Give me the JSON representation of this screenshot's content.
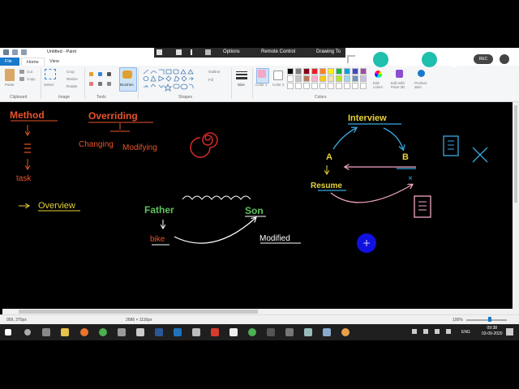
{
  "window": {
    "title": "Untitled - Paint"
  },
  "remote_bar": {
    "options": "Options",
    "remote_control": "Remote Control",
    "drawing_tools": "Drawing To"
  },
  "tabs": [
    "File",
    "Home",
    "View"
  ],
  "ribbon": {
    "clipboard": {
      "paste": "Paste",
      "cut": "Cut",
      "copy": "Copy",
      "label": "Clipboard"
    },
    "image": {
      "select": "Select",
      "crop": "Crop",
      "resize": "Resize",
      "rotate": "Rotate",
      "label": "Image"
    },
    "tools": {
      "label": "Tools"
    },
    "brushes": {
      "label": "Brushes"
    },
    "shapes": {
      "outline": "Outline",
      "fill": "Fill",
      "label": "Shapes"
    },
    "size": {
      "label": "Size"
    },
    "colors": {
      "color1": "Color 1",
      "color2": "Color 2",
      "edit_colors": "Edit colors",
      "edit_paint3d": "Edit with Paint 3D",
      "product_alert": "Product alert",
      "label": "Colors"
    }
  },
  "meeting": {
    "rec_label": "REC"
  },
  "drawing": {
    "method": "Method",
    "task": "task",
    "overriding": "Overriding",
    "changing": "Changing",
    "modifying": "Modifying",
    "overview": "Overview",
    "father": "Father",
    "son": "Son",
    "bike": "bike",
    "modified": "Modified",
    "interview": "Interview",
    "node_a": "A",
    "node_b": "B",
    "resume": "Resume",
    "mark_x": "×"
  },
  "status": {
    "cursor_pos": "959, 370px",
    "canvas_size": "2686 × 1116px",
    "zoom": "100%"
  },
  "taskbar": {
    "time": "09:38",
    "date": "03-09-2020",
    "lang": "ENG"
  },
  "colors": {
    "accent": "#1979ca",
    "orange": "#e8532b",
    "red": "#d62a2a",
    "yellow": "#e8d23a",
    "green": "#5ec25b",
    "light_blue": "#38a9e0",
    "pink": "#f4a8c8",
    "blue_dot": "#1010e0"
  }
}
